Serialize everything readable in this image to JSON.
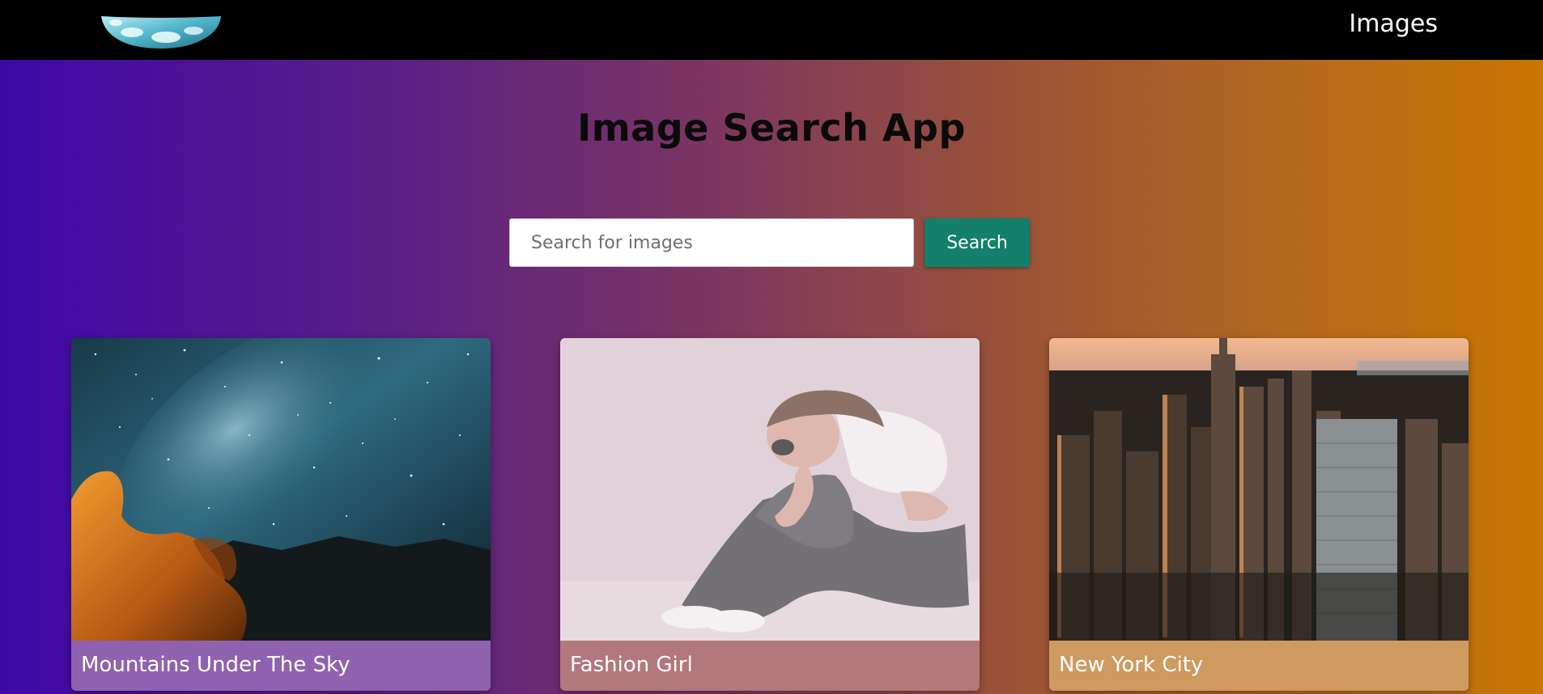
{
  "nav": {
    "logo": "cloud-moon-logo",
    "link_label": "Images"
  },
  "main": {
    "title": "Image Search App"
  },
  "search": {
    "placeholder": "Search for images",
    "value": "",
    "button_label": "Search",
    "button_color": "#12806a"
  },
  "results": [
    {
      "caption": "Mountains Under The Sky",
      "image": "milky-way-over-rocks"
    },
    {
      "caption": "Fashion Girl",
      "image": "girl-sitting-with-sunglasses"
    },
    {
      "caption": "New York City",
      "image": "manhattan-skyline-aerial"
    }
  ]
}
